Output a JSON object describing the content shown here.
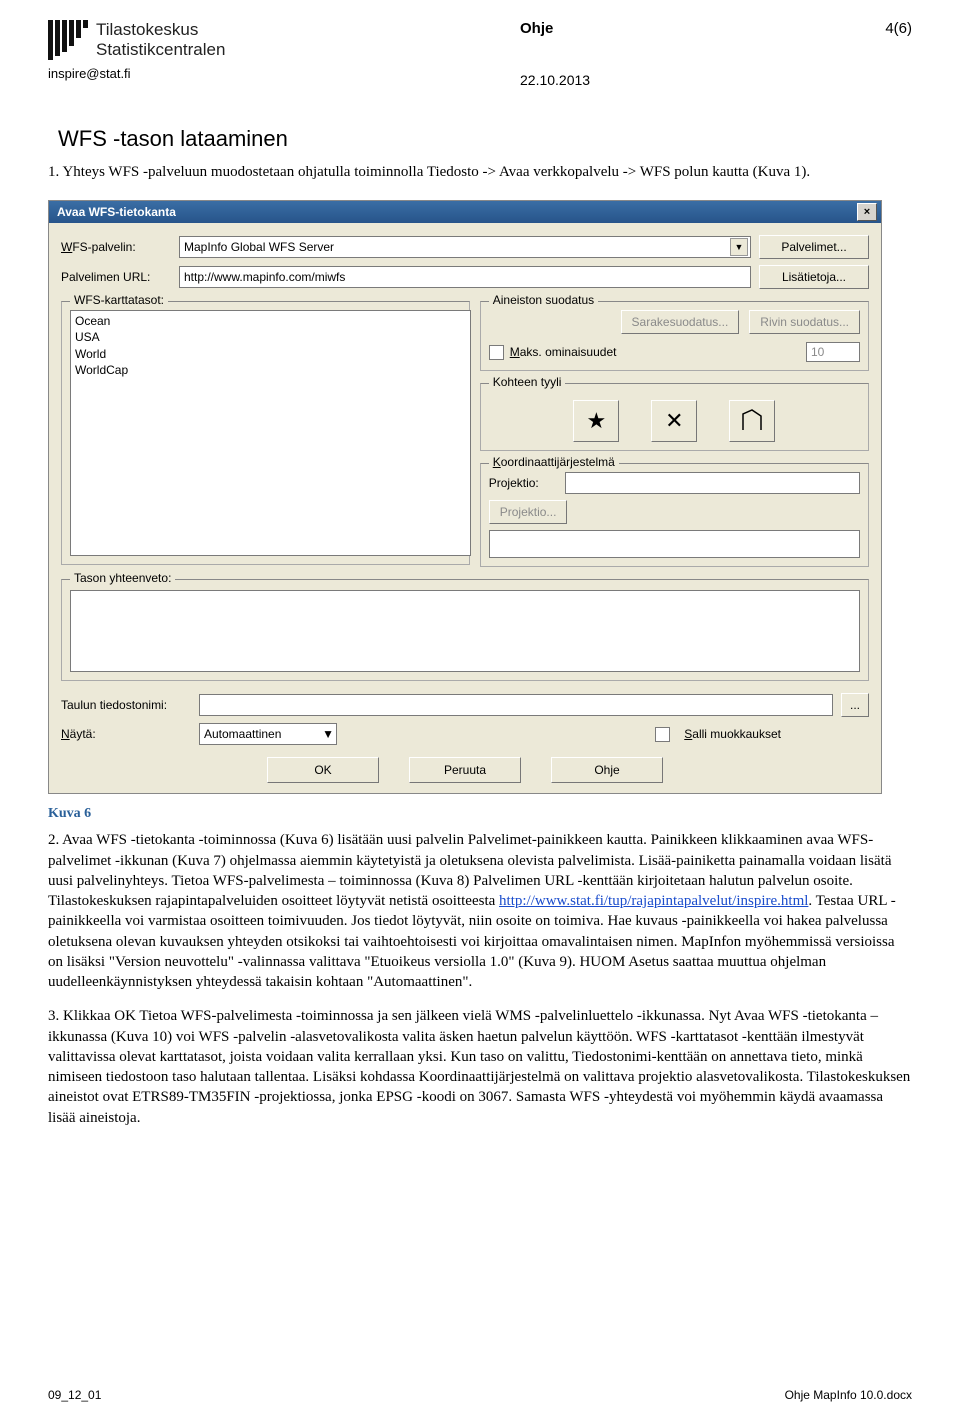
{
  "header": {
    "logo_line1": "Tilastokeskus",
    "logo_line2": "Statistikcentralen",
    "doc_type": "Ohje",
    "page_num": "4(6)",
    "email": "inspire@stat.fi",
    "date": "22.10.2013"
  },
  "section_title": "WFS -tason lataaminen",
  "para1": "1. Yhteys WFS -palveluun muodostetaan ohjatulla toiminnolla Tiedosto -> Avaa verkkopalvelu -> WFS polun kautta (Kuva 1).",
  "dialog": {
    "title": "Avaa WFS-tietokanta",
    "close": "×",
    "labels": {
      "server": "WFS-palvelin:",
      "url": "Palvelimen URL:",
      "layers_fs": "WFS-karttatasot:",
      "filter_fs": "Aineiston suodatus",
      "col_filter": "Sarakesuodatus...",
      "row_filter": "Rivin suodatus...",
      "max_props": "Maks. ominaisuudet",
      "style_fs": "Kohteen tyyli",
      "coord_fs": "Koordinaattijärjestelmä",
      "projection": "Projektio:",
      "proj_btn": "Projektio...",
      "summary_fs": "Tason yhteenveto:",
      "table_file": "Taulun tiedostonimi:",
      "show": "Näytä:",
      "allow_edits": "Salli muokkaukset",
      "servers_btn": "Palvelimet...",
      "more_btn": "Lisätietoja..."
    },
    "values": {
      "server": "MapInfo Global WFS Server",
      "url": "http://www.mapinfo.com/miwfs",
      "show_mode": "Automaattinen",
      "max_props_num": "10"
    },
    "layers": [
      "Ocean",
      "USA",
      "World",
      "WorldCap"
    ],
    "style_symbols": {
      "point": "★",
      "line": "✕",
      "region": "⬚"
    },
    "buttons": {
      "ok": "OK",
      "cancel": "Peruuta",
      "help": "Ohje",
      "ellipsis": "..."
    }
  },
  "caption": "Kuva 6",
  "para2_a": "2. Avaa WFS -tietokanta -toiminnossa (Kuva 6) lisätään uusi palvelin Palvelimet-painikkeen kautta. Painikkeen klikkaaminen avaa WFS-palvelimet -ikkunan (Kuva 7) ohjelmassa aiemmin käytetyistä ja oletuksena olevista palvelimista. Lisää-painiketta painamalla voidaan lisätä uusi palvelinyhteys. Tietoa WFS-palvelimesta – toiminnossa (Kuva 8)  Palvelimen URL -kenttään kirjoitetaan halutun palvelun osoite. Tilastokeskuksen rajapintapalveluiden osoitteet löytyvät netistä osoitteesta ",
  "para2_link": "http://www.stat.fi/tup/rajapintapalvelut/inspire.html",
  "para2_b": ". Testaa URL -painikkeella voi varmistaa osoitteen toimivuuden. Jos tiedot löytyvät, niin osoite on toimiva. Hae kuvaus -painikkeella voi hakea palvelussa oletuksena olevan kuvauksen yhteyden otsikoksi tai vaihtoehtoisesti voi kirjoittaa omavalintaisen nimen. MapInfon myöhemmissä versioissa on lisäksi \"Version neuvottelu\" -valinnassa valittava \"Etuoikeus versiolla 1.0\" (Kuva 9). HUOM Asetus saattaa muuttua ohjelman uudelleenkäynnistyksen yhteydessä takaisin kohtaan \"Automaattinen\".",
  "para3": "3. Klikkaa OK Tietoa WFS-palvelimesta -toiminnossa ja sen jälkeen vielä WMS -palvelinluettelo -ikkunassa. Nyt Avaa WFS -tietokanta –ikkunassa (Kuva 10) voi WFS -palvelin -alasvetovalikosta valita äsken haetun palvelun käyttöön. WFS -karttatasot -kenttään ilmestyvät valittavissa olevat karttatasot, joista voidaan valita kerrallaan yksi. Kun taso on valittu, Tiedostonimi-kenttään on annettava tieto, minkä nimiseen tiedostoon taso halutaan tallentaa. Lisäksi kohdassa Koordinaattijärjestelmä on valittava projektio alasvetovalikosta. Tilastokeskuksen aineistot ovat ETRS89-TM35FIN -projektiossa, jonka EPSG -koodi on 3067. Samasta WFS -yhteydestä voi myöhemmin käydä avaamassa lisää aineistoja.",
  "footer": {
    "left": "09_12_01",
    "right": "Ohje MapInfo 10.0.docx"
  }
}
